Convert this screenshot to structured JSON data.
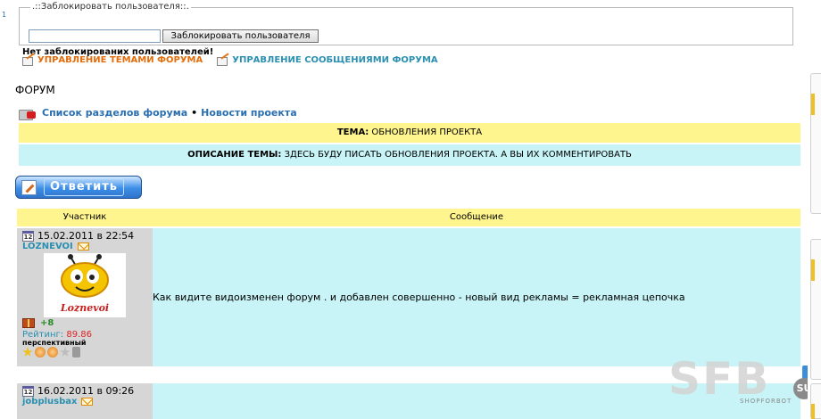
{
  "admin": {
    "block_legend": ".::Заблокировать пользователя::.",
    "block_input_value": "",
    "block_button": "Заблокировать пользователя",
    "no_blocked": "Нет заблокированих пользователей!",
    "manage_topics": "УПРАВЛЕНИЕ ТЕМАМИ ФОРУМА",
    "manage_messages": "УПРАВЛЕНИЕ СООБЩЕНИЯМИ ФОРУМА"
  },
  "page_title": "ФОРУМ",
  "breadcrumb": {
    "sections": "Список разделов форума",
    "separator": "•",
    "news": "Новости проекта"
  },
  "topic": {
    "label": "ТЕМА:",
    "value": "ОБНОВЛЕНИЯ ПРОЕКТА",
    "desc_label": "ОПИСАНИЕ ТЕМЫ:",
    "desc_value": "ЗДЕСЬ БУДУ ПИСАТЬ ОБНОВЛЕНИЯ ПРОЕКТА. А ВЫ ИХ КОММЕНТИРОВАТЬ"
  },
  "reply_button": "Ответить",
  "table": {
    "col_author": "Участник",
    "col_message": "Сообщение"
  },
  "posts": [
    {
      "date": "15.02.2011 в 22:54",
      "author": "LOZNEVOI",
      "avatar_text": "Loznevoi",
      "reputation": "+8",
      "rating_label": "Рейтинг:",
      "rating_value": "89.86",
      "rank": "перспективный",
      "message": "Как видите видоизменен форум . и добавлен совершенно - новый вид рекламы = рекламная цепочка"
    },
    {
      "date": "16.02.2011 в 09:26",
      "author": "jobplusbax"
    }
  ],
  "calendar_icon_text": "12",
  "watermark": {
    "text": "SFB",
    "su": "SU",
    "sub": "SHOPFORBOT"
  },
  "colors": {
    "topic_bg": "#fff58f",
    "desc_bg": "#c8f4f7",
    "link_orange": "#e46c0a",
    "link_teal": "#2a8fb0"
  }
}
